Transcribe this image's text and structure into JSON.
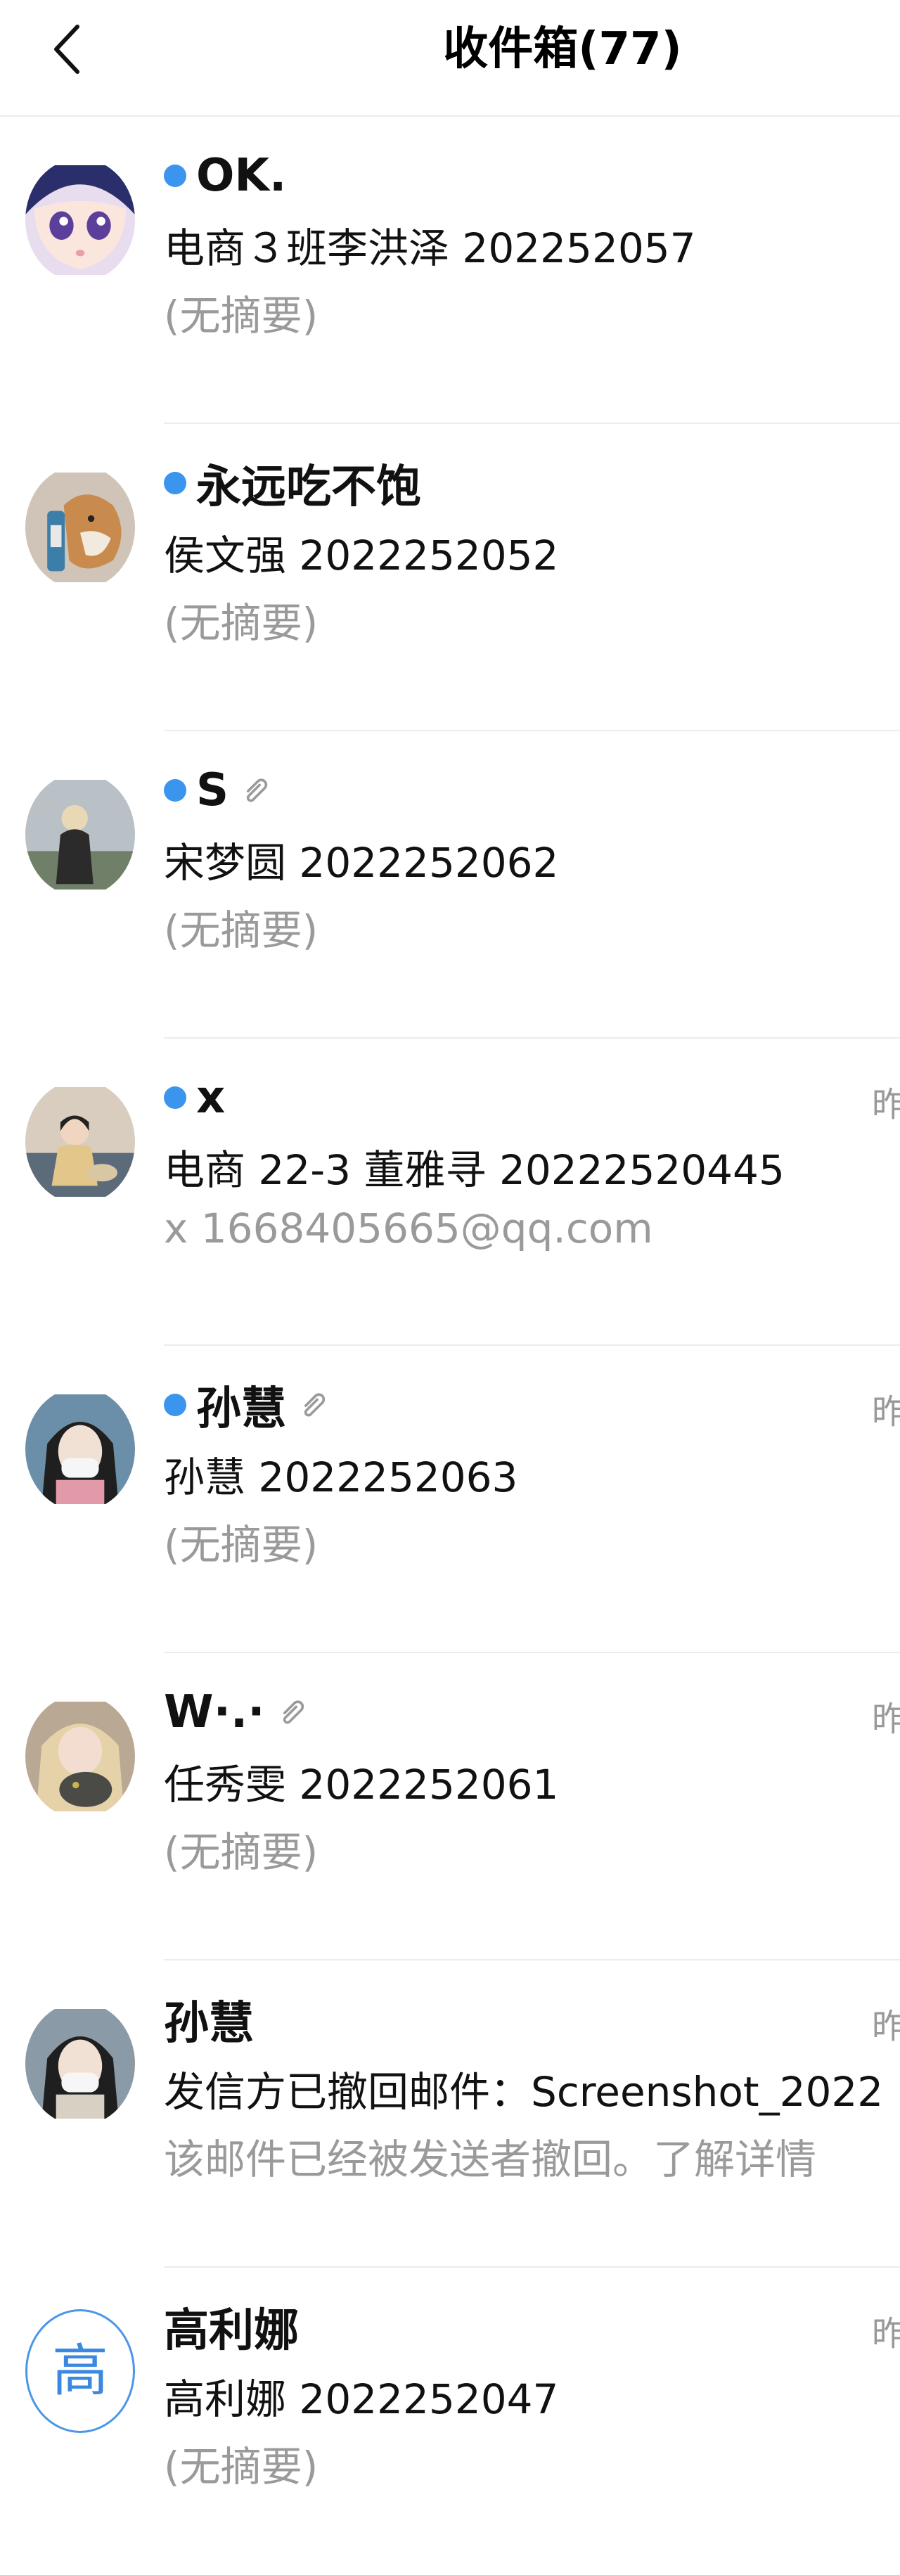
{
  "header": {
    "title": "收件箱(77)"
  },
  "emails": [
    {
      "sender": "OK.",
      "unread": true,
      "attachment": false,
      "time": "",
      "subject": "电商３班李洪泽 202252057",
      "summary": "(无摘要)"
    },
    {
      "sender": "永远吃不饱",
      "unread": true,
      "attachment": false,
      "time": "",
      "subject": "侯文强 2022252052",
      "summary": "(无摘要)"
    },
    {
      "sender": "S",
      "unread": true,
      "attachment": true,
      "time": "",
      "subject": "宋梦圆 2022252062",
      "summary": "(无摘要)"
    },
    {
      "sender": "x",
      "unread": true,
      "attachment": false,
      "time": "昨",
      "subject": "电商 22-3 董雅寻 20222520445",
      "summary": "x 1668405665@qq.com"
    },
    {
      "sender": " 孙慧",
      "unread": true,
      "attachment": true,
      "time": "昨",
      "subject": "孙慧 2022252063",
      "summary": "(无摘要)"
    },
    {
      "sender": "W·.·",
      "unread": false,
      "attachment": true,
      "time": "昨",
      "subject": "任秀雯 2022252061",
      "summary": "(无摘要)"
    },
    {
      "sender": " 孙慧",
      "unread": false,
      "attachment": false,
      "time": "昨",
      "subject": "发信方已撤回邮件：Screenshot_2022",
      "summary": "该邮件已经被发送者撤回。了解详情"
    },
    {
      "sender": "高利娜",
      "unread": false,
      "attachment": false,
      "time": "昨",
      "subject": "高利娜 2022252047",
      "summary": "(无摘要)",
      "avatar_letter": "高"
    }
  ]
}
